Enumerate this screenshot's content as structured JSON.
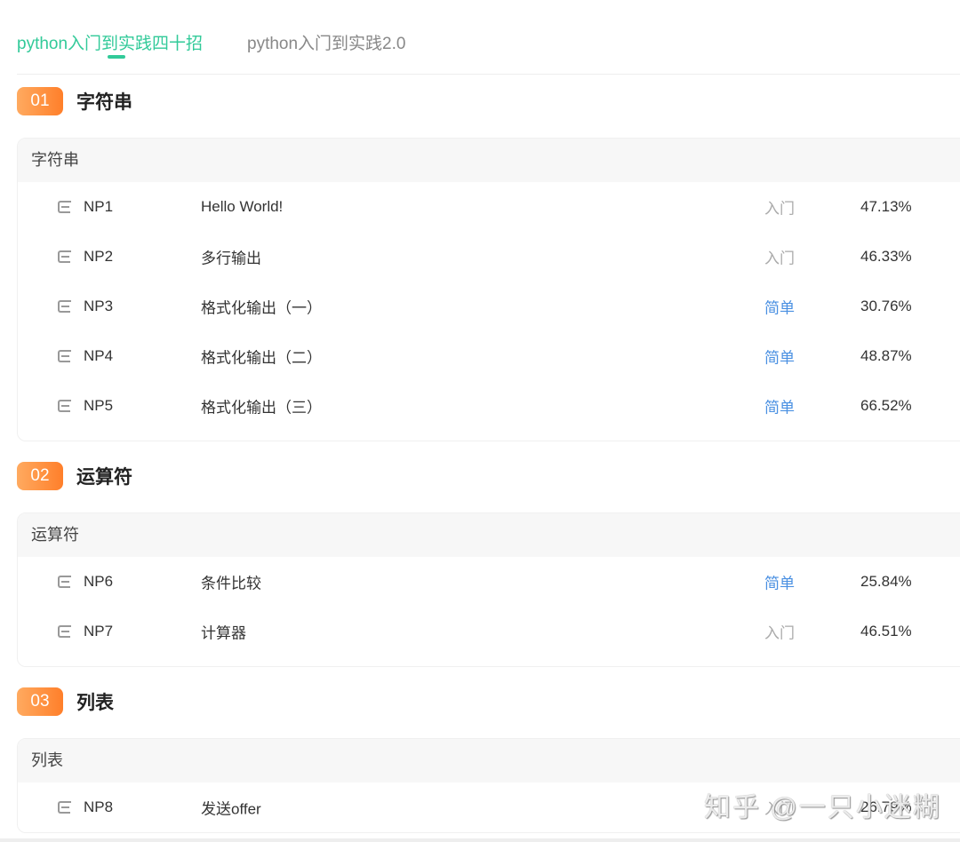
{
  "tabs": [
    {
      "label": "python入门到实践四十招",
      "active": true
    },
    {
      "label": "python入门到实践2.0",
      "active": false
    }
  ],
  "sections": [
    {
      "num": "01",
      "title": "字符串",
      "card_title": "字符串",
      "rows": [
        {
          "id": "NP1",
          "name": "Hello World!",
          "level": "入门",
          "rate": "47.13%"
        },
        {
          "id": "NP2",
          "name": "多行输出",
          "level": "入门",
          "rate": "46.33%"
        },
        {
          "id": "NP3",
          "name": "格式化输出（一）",
          "level": "简单",
          "rate": "30.76%"
        },
        {
          "id": "NP4",
          "name": "格式化输出（二）",
          "level": "简单",
          "rate": "48.87%"
        },
        {
          "id": "NP5",
          "name": "格式化输出（三）",
          "level": "简单",
          "rate": "66.52%"
        }
      ]
    },
    {
      "num": "02",
      "title": "运算符",
      "card_title": "运算符",
      "rows": [
        {
          "id": "NP6",
          "name": "条件比较",
          "level": "简单",
          "rate": "25.84%"
        },
        {
          "id": "NP7",
          "name": "计算器",
          "level": "入门",
          "rate": "46.51%"
        }
      ]
    },
    {
      "num": "03",
      "title": "列表",
      "card_title": "列表",
      "rows": [
        {
          "id": "NP8",
          "name": "发送offer",
          "level": "入门",
          "rate": "26.79%"
        }
      ]
    }
  ],
  "watermark": "知乎 @一只小迷糊",
  "colors": {
    "accent": "#32ca99",
    "badge": "#ff8c3a",
    "easy": "#4a90e2"
  }
}
